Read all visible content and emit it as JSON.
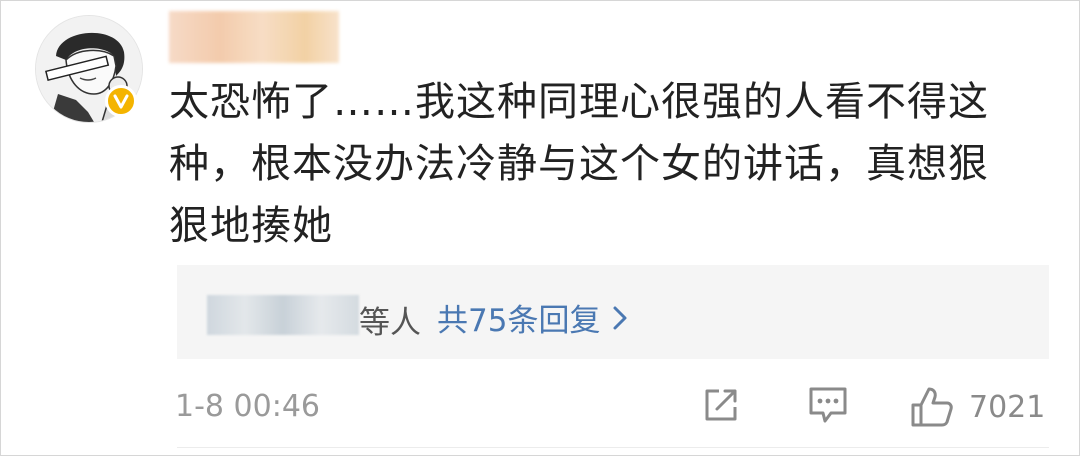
{
  "comment": {
    "text": "太恐怖了……我这种同理心很强的人看不得这种，根本没办法冷静与这个女的讲话，真想狠狠地揍她",
    "timestamp": "1-8 00:46",
    "likes": "7021"
  },
  "replies": {
    "suffix": "等人",
    "summary": "共75条回复"
  },
  "icons": {
    "verified": "verified-badge-icon",
    "share": "share-icon",
    "comment": "comment-icon",
    "like": "thumbs-up-icon",
    "chevron": "chevron-right-icon"
  },
  "colors": {
    "link": "#4a78b2",
    "verified_badge": "#f4b400",
    "text": "#222222",
    "meta": "#9a9a9a"
  }
}
